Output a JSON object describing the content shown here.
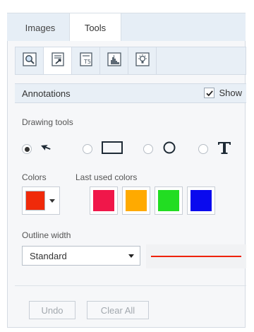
{
  "tabs": [
    {
      "label": "Images",
      "active": false
    },
    {
      "label": "Tools",
      "active": true
    }
  ],
  "toolbar": {
    "buttons": [
      {
        "icon": "zoom-selection-icon"
      },
      {
        "icon": "annotations-icon",
        "active": true
      },
      {
        "icon": "text-icon"
      },
      {
        "icon": "histogram-icon"
      },
      {
        "icon": "brightness-icon"
      }
    ]
  },
  "annotations": {
    "title": "Annotations",
    "show_label": "Show",
    "show_checked": true
  },
  "drawing_tools": {
    "label": "Drawing tools",
    "options": [
      {
        "icon": "arrow-icon",
        "selected": true
      },
      {
        "icon": "rectangle-icon",
        "selected": false
      },
      {
        "icon": "ellipse-icon",
        "selected": false
      },
      {
        "icon": "text-tool-icon",
        "selected": false
      }
    ]
  },
  "colors": {
    "label": "Colors",
    "current": "#f02a0a",
    "last_used_label": "Last used colors",
    "last_used": [
      "#f0174a",
      "#ffaa00",
      "#22dd22",
      "#0a0aee"
    ]
  },
  "outline": {
    "label": "Outline width",
    "selected": "Standard",
    "preview_color": "#ee2200"
  },
  "actions": {
    "undo_label": "Undo",
    "clear_label": "Clear All"
  }
}
